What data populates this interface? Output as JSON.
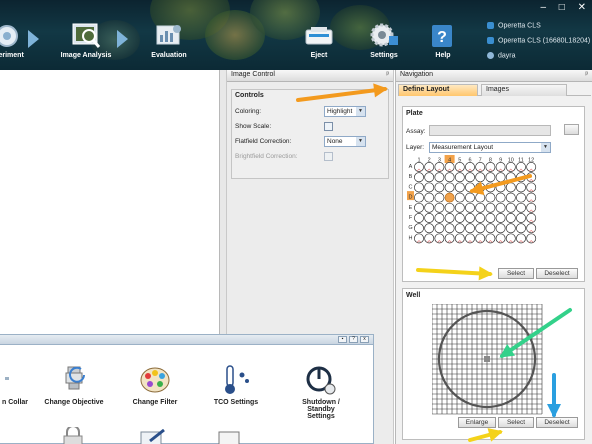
{
  "window": {
    "controls": {
      "minimize": "–",
      "maximize": "□",
      "close": "✕"
    }
  },
  "toolbar": {
    "items": [
      {
        "label": "periment",
        "icon": "experiment-icon"
      },
      {
        "label": "Image Analysis",
        "icon": "image-analysis-icon"
      },
      {
        "label": "Evaluation",
        "icon": "evaluation-icon"
      },
      {
        "label": "Eject",
        "icon": "eject-icon"
      },
      {
        "label": "Settings",
        "icon": "settings-icon"
      },
      {
        "label": "Help",
        "icon": "help-icon"
      }
    ],
    "status": [
      {
        "text": "Operetta CLS"
      },
      {
        "text": "Operetta CLS (16680L18204)"
      },
      {
        "text": "dayra"
      }
    ]
  },
  "image_control": {
    "title": "Image Control",
    "controls_title": "Controls",
    "coloring_label": "Coloring:",
    "coloring_value": "Highlight",
    "show_scale_label": "Show Scale:",
    "flatfield_label": "Flatfield Correction:",
    "flatfield_value": "None",
    "brightfield_label": "Brightfield Correction:"
  },
  "navigation": {
    "title": "Navigation",
    "tabs": [
      {
        "label": "Define Layout",
        "active": true
      },
      {
        "label": "Images",
        "active": false
      }
    ],
    "plate": {
      "title": "Plate",
      "assay_label": "Assay:",
      "layer_label": "Layer:",
      "layer_value": "Measurement Layout",
      "columns": [
        "1",
        "2",
        "3",
        "4",
        "5",
        "6",
        "7",
        "8",
        "9",
        "10",
        "11",
        "12"
      ],
      "rows": [
        "A",
        "B",
        "C",
        "D",
        "E",
        "F",
        "G",
        "H"
      ],
      "highlighted_row": "D",
      "highlighted_column": "4",
      "select_label": "Select",
      "deselect_label": "Deselect"
    },
    "well": {
      "title": "Well",
      "enlarge_label": "Enlarge",
      "select_label": "Select",
      "deselect_label": "Deselect"
    }
  },
  "palette": {
    "mini_buttons": [
      "▪",
      "?",
      "x"
    ],
    "items": [
      {
        "label": "n Collar",
        "icon": "objective-collar-icon"
      },
      {
        "label": "Change Objective",
        "icon": "change-objective-icon"
      },
      {
        "label": "Change Filter",
        "icon": "change-filter-icon"
      },
      {
        "label": "TCO Settings",
        "icon": "tco-settings-icon"
      },
      {
        "label": "Shutdown / Standby",
        "label2": "Settings",
        "icon": "shutdown-icon"
      }
    ]
  },
  "colors": {
    "accent_orange": "#f39a1e",
    "arrow_yellow": "#f4d21a",
    "arrow_green": "#33d18a",
    "arrow_blue": "#2a9fe0",
    "active_tab": "#ffc66d",
    "selected_well": "#f2a24a"
  }
}
